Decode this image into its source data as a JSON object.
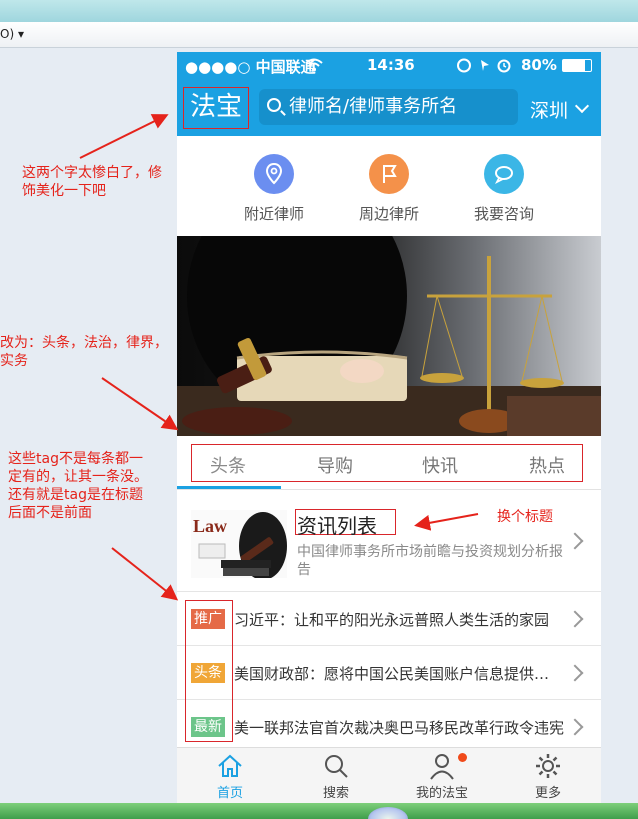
{
  "desktop": {
    "menu_fragment": "O) ▾"
  },
  "status_bar": {
    "carrier": "●●●●○ 中国联通",
    "time": "14:36",
    "battery": "80%"
  },
  "header": {
    "logo_text": "法宝",
    "search_placeholder": "律师名/律师事务所名",
    "city": "深圳"
  },
  "quick_actions": [
    {
      "label": "附近律师",
      "icon": "location-pin-icon",
      "color": "#6b8ef0"
    },
    {
      "label": "周边律所",
      "icon": "flag-icon",
      "color": "#f4914a"
    },
    {
      "label": "我要咨询",
      "icon": "chat-bubble-icon",
      "color": "#3bb6e6"
    }
  ],
  "tabs": [
    {
      "label": "头条"
    },
    {
      "label": "导购"
    },
    {
      "label": "快讯"
    },
    {
      "label": "热点"
    }
  ],
  "feature": {
    "thumb_text": "Law",
    "title": "资讯列表",
    "desc": "中国律师事务所市场前瞻与投资规划分析报告"
  },
  "news": [
    {
      "tag": "推广",
      "tag_color": "#e56a47",
      "text": "习近平：让和平的阳光永远普照人类生活的家园"
    },
    {
      "tag": "头条",
      "tag_color": "#f0a637",
      "text": "美国财政部：愿将中国公民美国账户信息提供给中方"
    },
    {
      "tag": "最新",
      "tag_color": "#6cc58a",
      "text": "美一联邦法官首次裁决奥巴马移民改革行政令违宪"
    }
  ],
  "tabbar": [
    {
      "label": "首页",
      "icon": "home-icon",
      "active": true
    },
    {
      "label": "搜索",
      "icon": "search-icon",
      "active": false
    },
    {
      "label": "我的法宝",
      "icon": "user-icon",
      "active": false
    },
    {
      "label": "更多",
      "icon": "gear-icon",
      "active": false
    }
  ],
  "annotations": {
    "logo_note": "这两个字太惨白了，修饰美化一下吧",
    "tabs_note": "改为：头条，法治，律界，实务",
    "tags_note": "这些tag不是每条都一定有的，让其一条没。还有就是tag是在标题后面不是前面",
    "title_note": "换个标题"
  },
  "colors": {
    "accent": "#1ba1e2",
    "annotation": "#e5231b"
  }
}
